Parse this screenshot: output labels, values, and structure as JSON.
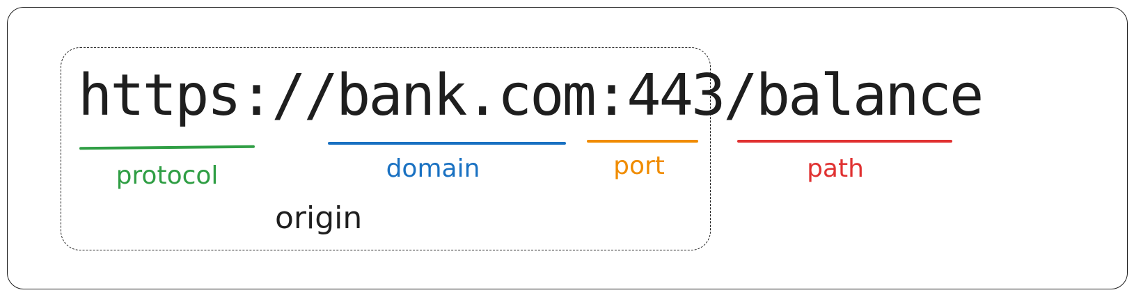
{
  "url": {
    "protocol": "https:",
    "slashes": "//",
    "domain": "bank.com",
    "colon": ":",
    "port": "443",
    "path": "/balance"
  },
  "labels": {
    "protocol": "protocol",
    "domain": "domain",
    "port": "port",
    "path": "path",
    "origin": "origin"
  },
  "colors": {
    "protocol": "#2f9e44",
    "domain": "#1971c2",
    "port": "#f08c00",
    "path": "#e03131",
    "ink": "#1e1e1e"
  }
}
